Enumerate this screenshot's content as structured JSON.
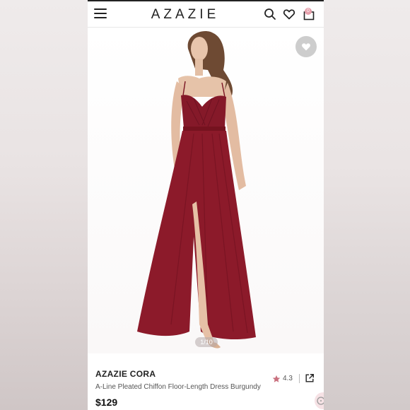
{
  "header": {
    "brand": "AZAZIE",
    "cart_count": "0"
  },
  "gallery": {
    "counter": "1/10"
  },
  "product": {
    "name": "AZAZIE CORA",
    "description": "A-Line Pleated Chiffon Floor-Length Dress Burgundy",
    "price": "$129",
    "rating": "4.3"
  },
  "icons": {
    "menu": "hamburger-menu-icon",
    "search": "search-icon",
    "wishlist": "heart-icon",
    "cart": "shopping-bag-icon",
    "rating": "star-icon",
    "share": "share-icon"
  },
  "colors": {
    "dress": "#8c1a2a",
    "star": "#c9707e",
    "badge": "#e7a0ac",
    "wish_button": "#cdcdcd"
  }
}
